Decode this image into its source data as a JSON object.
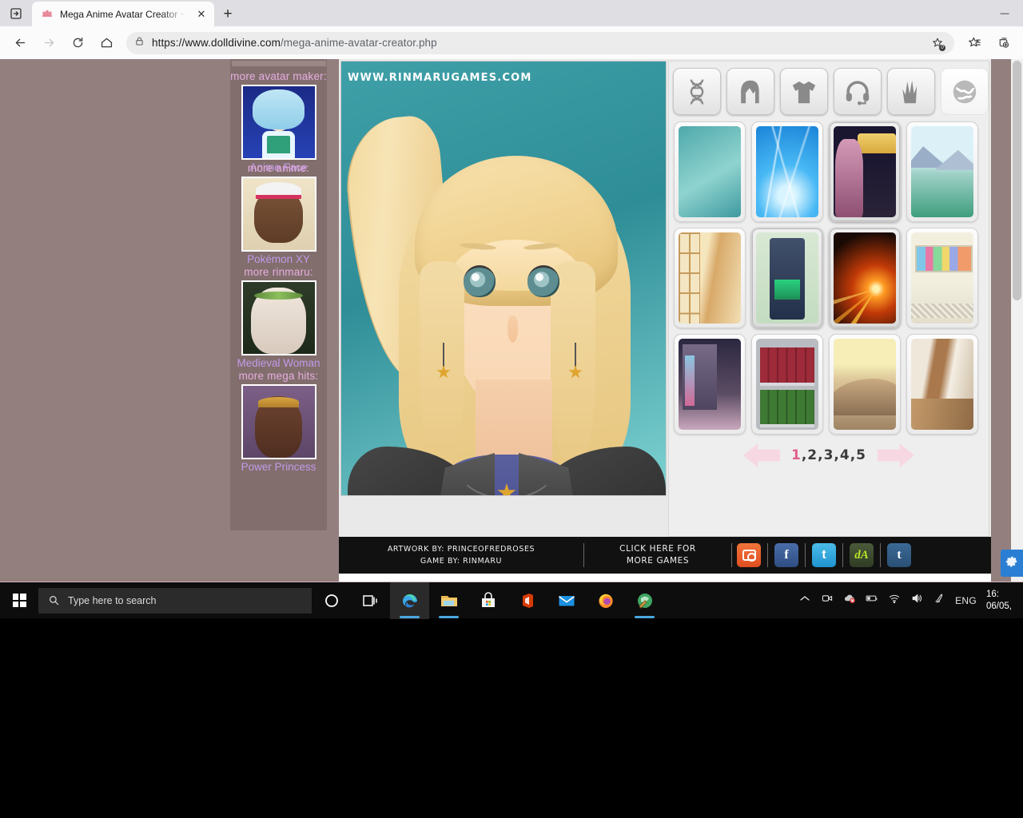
{
  "browser": {
    "tab": {
      "title": "Mega Anime Avatar Creator ~ U",
      "favicon_name": "dolldivine-crown-icon",
      "close_label": "✕",
      "newtab_label": "+"
    },
    "window_controls": {
      "minimize": "—",
      "maximize": "☐",
      "close": "✕"
    },
    "toolbar": {
      "back_label": "←",
      "forward_label": "→",
      "refresh_label": "↻",
      "home_label": "⌂",
      "lock_name": "site-security-lock-icon",
      "url_domain": "https://www.dolldivine.com",
      "url_path": "/mega-anime-avatar-creator.php",
      "favorite_add": "add-favorite-star-icon",
      "favorites_list": "favorites-list-icon",
      "collections": "collections-icon",
      "badge": "0"
    }
  },
  "sidebar": {
    "sections": [
      {
        "label": "more avatar maker:",
        "thumb": "th-anime",
        "name": "Anime Face"
      },
      {
        "label": "more anime:",
        "thumb": "th-pkmn",
        "name": "Pokémon XY"
      },
      {
        "label": "more rinmaru:",
        "thumb": "th-medieval",
        "name": "Medieval Woman"
      },
      {
        "label": "more mega hits:",
        "thumb": "th-power",
        "name": "Power Princess"
      }
    ]
  },
  "game": {
    "watermark": "WWW.RINMARUGAMES.COM",
    "categories": [
      {
        "name": "body-dna-category",
        "icon": "dna-icon",
        "selected": false
      },
      {
        "name": "hair-category",
        "icon": "hair-icon",
        "selected": false
      },
      {
        "name": "clothes-category",
        "icon": "tshirt-icon",
        "selected": false
      },
      {
        "name": "accessories-category",
        "icon": "headset-icon",
        "selected": false
      },
      {
        "name": "hands-category",
        "icon": "hand-icon",
        "selected": false
      },
      {
        "name": "background-category",
        "icon": "globe-icon",
        "selected": true
      }
    ],
    "thumbnails": [
      {
        "name": "plain-teal-background",
        "art": "bg-plain",
        "selected": false
      },
      {
        "name": "blue-light-rays-background",
        "art": "bg-lines",
        "selected": false
      },
      {
        "name": "festival-stall-background",
        "art": "bg-festival",
        "selected": false
      },
      {
        "name": "misty-mountains-background",
        "art": "bg-mountain",
        "selected": false
      },
      {
        "name": "shoji-screen-background",
        "art": "bg-shoji",
        "selected": false
      },
      {
        "name": "arcade-machine-background",
        "art": "bg-arcade",
        "selected": true
      },
      {
        "name": "fireworks-background",
        "art": "bg-fireworks",
        "selected": true
      },
      {
        "name": "train-interior-background",
        "art": "bg-train",
        "selected": false
      },
      {
        "name": "night-city-street-background",
        "art": "bg-city",
        "selected": false
      },
      {
        "name": "bookshelf-background",
        "art": "bg-books",
        "selected": false
      },
      {
        "name": "desert-dunes-background",
        "art": "bg-desert",
        "selected": false
      },
      {
        "name": "school-hallway-background",
        "art": "bg-hall",
        "selected": false
      }
    ],
    "pager": {
      "prev_label": "◀",
      "next_label": "▶",
      "current": "1",
      "rest": ",2,3,4,5"
    },
    "footer": {
      "artwork_line": "ARTWORK BY: PRINCEOFREDROSES",
      "game_line": "GAME BY: RINMARU",
      "more_games_line1": "CLICK HERE FOR",
      "more_games_line2": "MORE GAMES",
      "socials": [
        {
          "name": "instagram-share-button",
          "glyph": ""
        },
        {
          "name": "facebook-share-button",
          "glyph": "f"
        },
        {
          "name": "twitter-share-button",
          "glyph": "t"
        },
        {
          "name": "deviantart-share-button",
          "glyph": "dA"
        },
        {
          "name": "tumblr-share-button",
          "glyph": "t"
        }
      ]
    }
  },
  "taskbar": {
    "search_placeholder": "Type here to search",
    "apps": [
      {
        "name": "cortana-button",
        "active": false,
        "running": false
      },
      {
        "name": "task-view-button",
        "active": false,
        "running": false
      },
      {
        "name": "microsoft-edge-button",
        "active": true,
        "running": true
      },
      {
        "name": "file-explorer-button",
        "active": false,
        "running": true
      },
      {
        "name": "microsoft-store-button",
        "active": false,
        "running": false
      },
      {
        "name": "office-button",
        "active": false,
        "running": false
      },
      {
        "name": "mail-button",
        "active": false,
        "running": false
      },
      {
        "name": "firefox-button",
        "active": false,
        "running": false
      },
      {
        "name": "paint-app-button",
        "active": false,
        "running": true
      }
    ],
    "tray": {
      "show_hidden": "show-hidden-icons-chevron",
      "meet_now": "meet-now-icon",
      "onedrive": "onedrive-error-icon",
      "battery": "battery-icon",
      "network": "wifi-icon",
      "volume": "volume-icon",
      "pen": "windows-ink-icon",
      "language": "ENG",
      "time": "16:",
      "date": "06/05,"
    },
    "settings_fab": "settings-gear-button"
  },
  "colors": {
    "page_bg": "#927f7e",
    "sidebar_bg": "#826e6d",
    "accent_pink": "#e6aee0",
    "accent_purple": "#c39ae9",
    "taskbar": "#0d0d0d",
    "canvas_teal": "#3fa0a8"
  }
}
